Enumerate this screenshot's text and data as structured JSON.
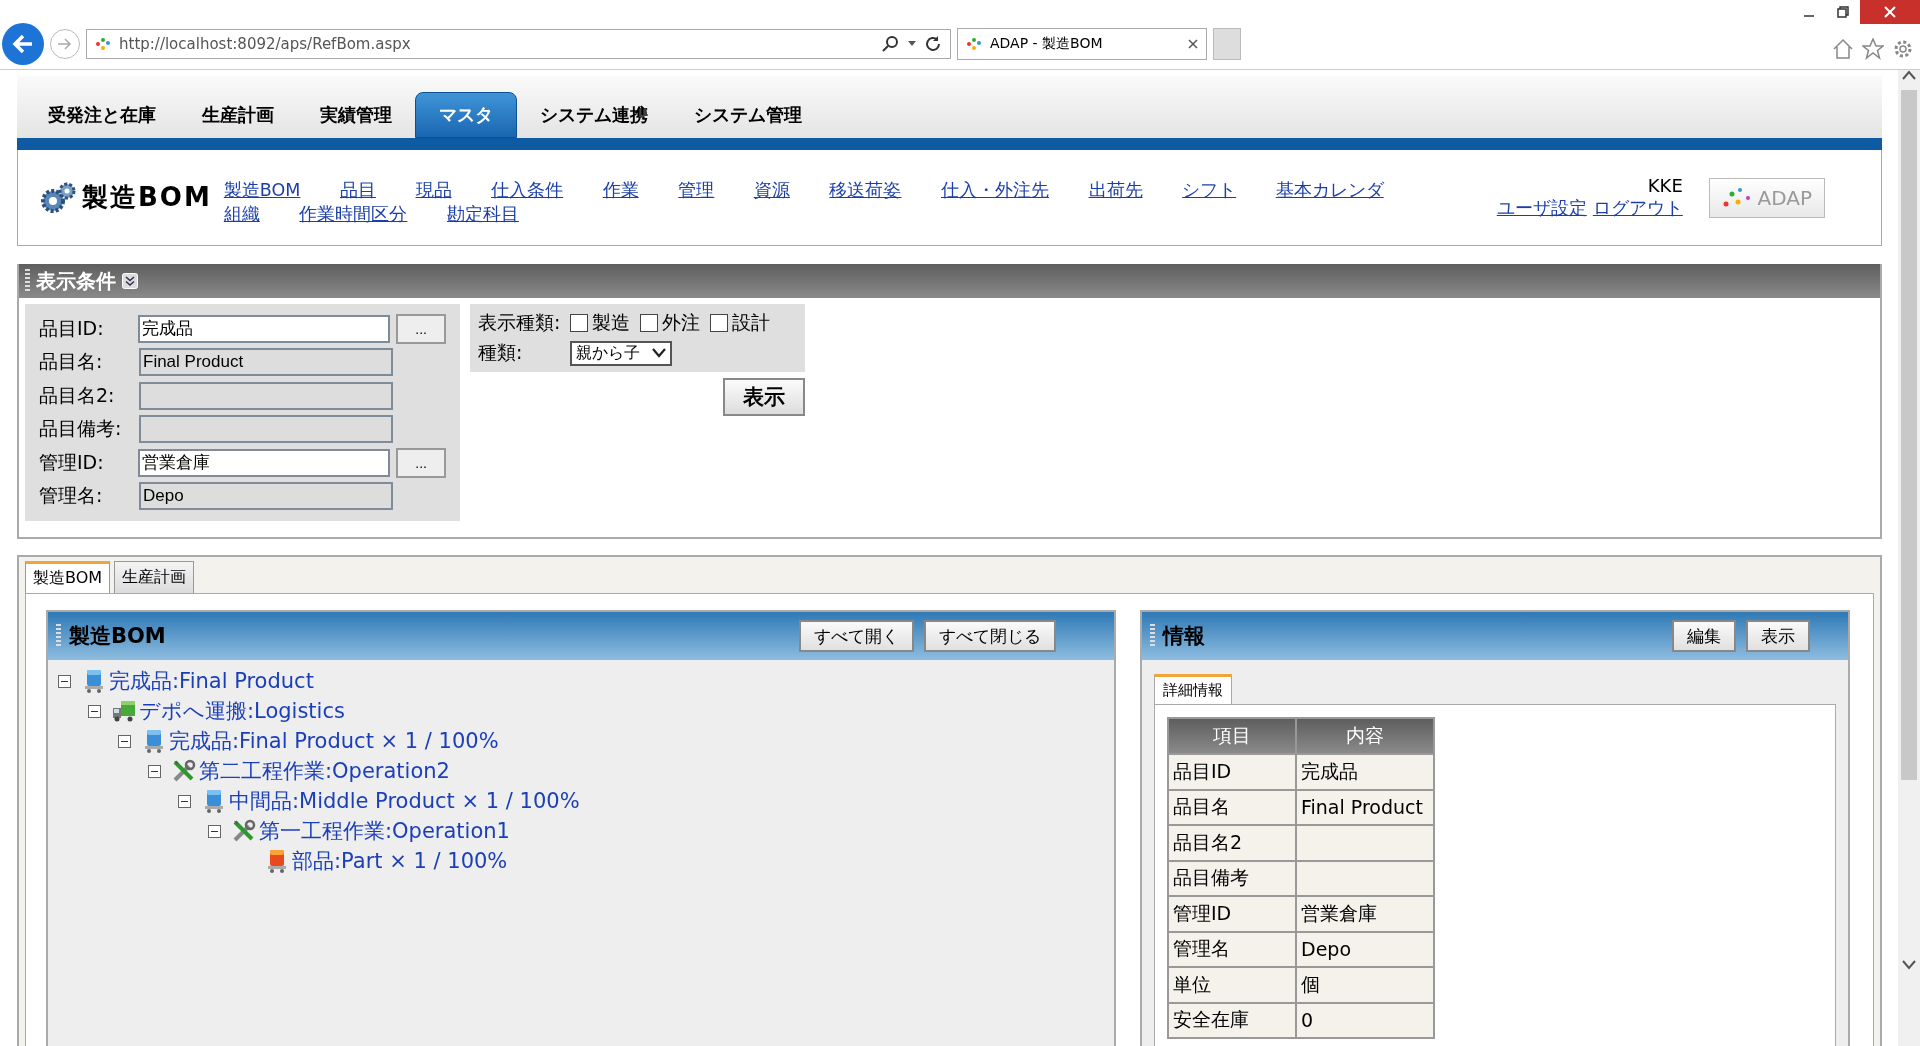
{
  "browser": {
    "url": "http://localhost:8092/aps/RefBom.aspx",
    "tab_title": "ADAP - 製造BOM"
  },
  "nav_tabs": [
    {
      "label": "受発注と在庫",
      "selected": false
    },
    {
      "label": "生産計画",
      "selected": false
    },
    {
      "label": "実績管理",
      "selected": false
    },
    {
      "label": "マスタ",
      "selected": true
    },
    {
      "label": "システム連携",
      "selected": false
    },
    {
      "label": "システム管理",
      "selected": false
    }
  ],
  "header": {
    "title": "製造BOM",
    "links": [
      "製造BOM",
      "品目",
      "現品",
      "仕入条件",
      "作業",
      "管理",
      "資源",
      "移送荷姿",
      "仕入・外注先",
      "出荷先",
      "シフト",
      "基本カレンダ",
      "組織",
      "作業時間区分",
      "勘定科目"
    ],
    "user": "KKE",
    "user_links": [
      "ユーザ設定",
      "ログアウト"
    ],
    "logo": "ADAP"
  },
  "conditions": {
    "title": "表示条件",
    "fields": [
      {
        "label": "品目ID:",
        "value": "完成品",
        "editable": true,
        "lookup": "..."
      },
      {
        "label": "品目名:",
        "value": "Final Product",
        "editable": false
      },
      {
        "label": "品目名2:",
        "editable": false
      },
      {
        "label": "品目備考:",
        "editable": false
      },
      {
        "label": "管理ID:",
        "value": "営業倉庫",
        "editable": true,
        "lookup": "..."
      },
      {
        "label": "管理名:",
        "value": "Depo",
        "editable": false
      }
    ],
    "display_kind_label": "表示種類:",
    "display_kinds": [
      {
        "label": "製造",
        "checked": false
      },
      {
        "label": "外注",
        "checked": false
      },
      {
        "label": "設計",
        "checked": false
      }
    ],
    "type_label": "種類:",
    "type_value": "親から子",
    "submit": "表示"
  },
  "tabs": [
    {
      "label": "製造BOM",
      "selected": true
    },
    {
      "label": "生産計画",
      "selected": false
    }
  ],
  "bom": {
    "title": "製造BOM",
    "buttons": [
      "すべて開く",
      "すべて閉じる"
    ],
    "tree": [
      {
        "kind": "product",
        "label": "完成品:Final Product",
        "expanded": true,
        "children": [
          {
            "kind": "logistics",
            "label": "デポへ運搬:Logistics",
            "expanded": true,
            "children": [
              {
                "kind": "product",
                "label": "完成品:Final Product × 1 / 100%",
                "expanded": true,
                "children": [
                  {
                    "kind": "operation",
                    "label": "第二工程作業:Operation2",
                    "expanded": true,
                    "children": [
                      {
                        "kind": "product",
                        "label": "中間品:Middle Product × 1 / 100%",
                        "expanded": true,
                        "children": [
                          {
                            "kind": "operation",
                            "label": "第一工程作業:Operation1",
                            "expanded": true,
                            "children": [
                              {
                                "kind": "part",
                                "label": "部品:Part × 1 / 100%"
                              }
                            ]
                          }
                        ]
                      }
                    ]
                  }
                ]
              }
            ]
          }
        ]
      }
    ]
  },
  "info": {
    "title": "情報",
    "buttons": [
      "編集",
      "表示"
    ],
    "tab": "詳細情報",
    "columns": [
      "項目",
      "内容"
    ],
    "rows": [
      [
        "品目ID",
        "完成品"
      ],
      [
        "品目名",
        "Final Product"
      ],
      [
        "品目名2",
        ""
      ],
      [
        "品目備考",
        ""
      ],
      [
        "管理ID",
        "営業倉庫"
      ],
      [
        "管理名",
        "Depo"
      ],
      [
        "単位",
        "個"
      ],
      [
        "安全在庫",
        "0"
      ]
    ]
  }
}
